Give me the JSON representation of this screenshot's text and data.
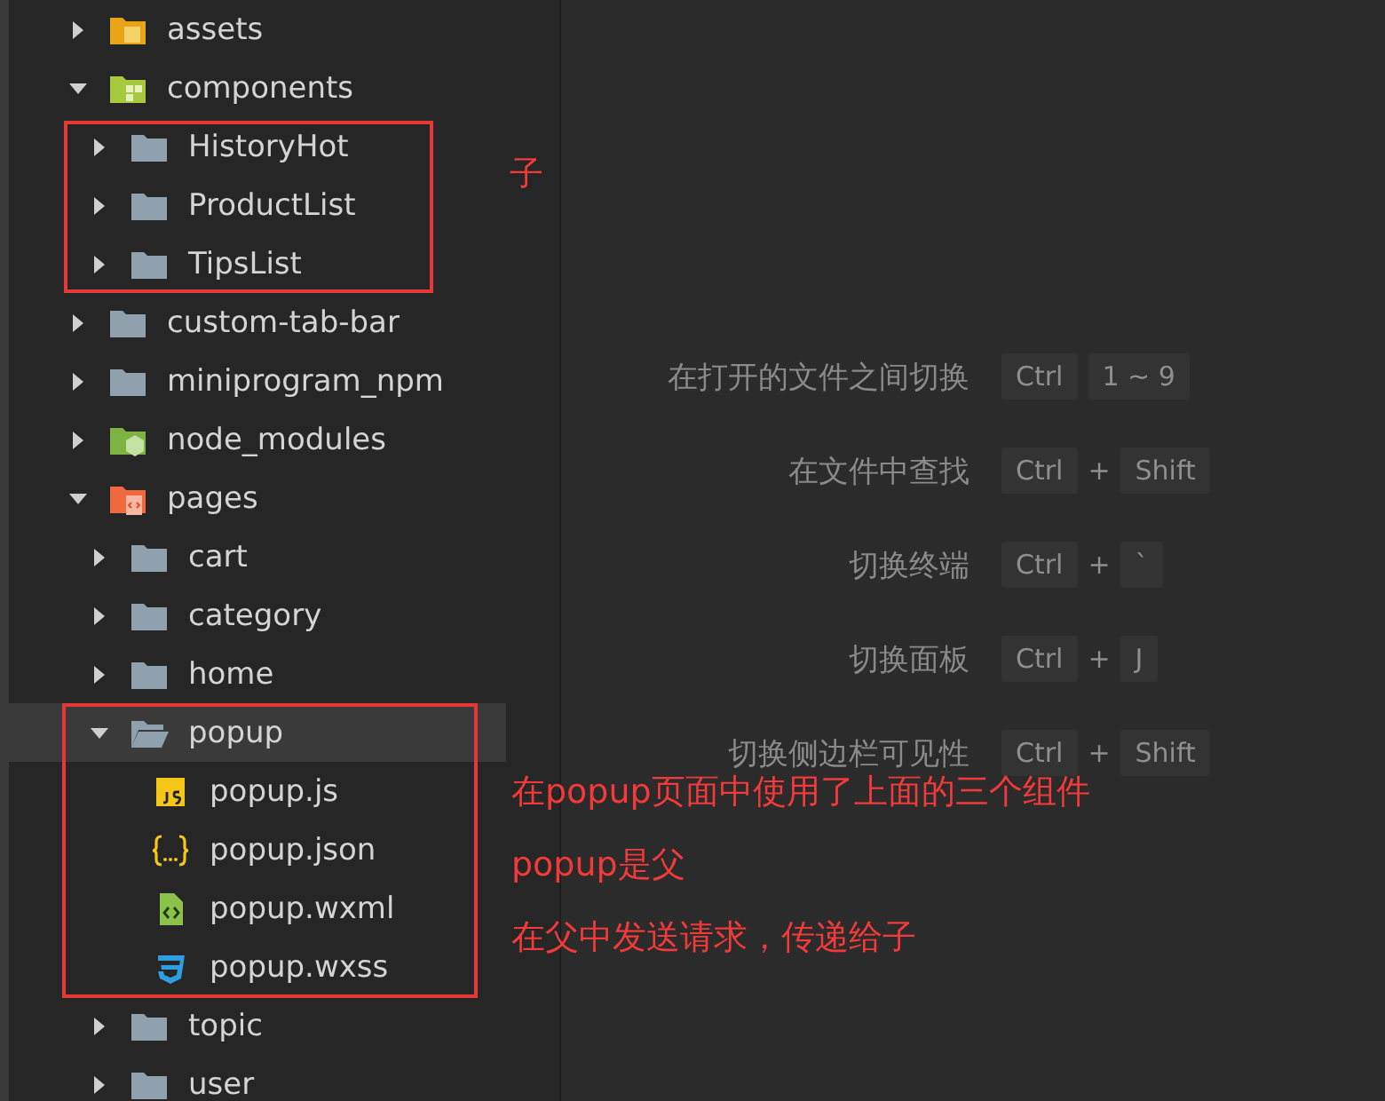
{
  "explorer": {
    "items": [
      {
        "name": "assets",
        "kind": "folder-assets",
        "expanded": false,
        "selected": false
      },
      {
        "name": "components",
        "kind": "folder-components",
        "expanded": true,
        "selected": false,
        "children": [
          {
            "name": "HistoryHot",
            "kind": "folder",
            "expanded": false,
            "selected": false
          },
          {
            "name": "ProductList",
            "kind": "folder",
            "expanded": false,
            "selected": false
          },
          {
            "name": "TipsList",
            "kind": "folder",
            "expanded": false,
            "selected": false
          }
        ]
      },
      {
        "name": "custom-tab-bar",
        "kind": "folder",
        "expanded": false,
        "selected": false
      },
      {
        "name": "miniprogram_npm",
        "kind": "folder",
        "expanded": false,
        "selected": false
      },
      {
        "name": "node_modules",
        "kind": "folder-node",
        "expanded": false,
        "selected": false
      },
      {
        "name": "pages",
        "kind": "folder-pages",
        "expanded": true,
        "selected": false,
        "children": [
          {
            "name": "cart",
            "kind": "folder",
            "expanded": false,
            "selected": false
          },
          {
            "name": "category",
            "kind": "folder",
            "expanded": false,
            "selected": false
          },
          {
            "name": "home",
            "kind": "folder",
            "expanded": false,
            "selected": false
          },
          {
            "name": "popup",
            "kind": "folder",
            "expanded": true,
            "selected": true,
            "children": [
              {
                "name": "popup.js",
                "kind": "js",
                "selected": false
              },
              {
                "name": "popup.json",
                "kind": "json",
                "selected": false
              },
              {
                "name": "popup.wxml",
                "kind": "wxml",
                "selected": false
              },
              {
                "name": "popup.wxss",
                "kind": "wxss",
                "selected": false
              }
            ]
          },
          {
            "name": "topic",
            "kind": "folder",
            "expanded": false,
            "selected": false
          },
          {
            "name": "user",
            "kind": "folder",
            "expanded": false,
            "selected": false
          }
        ]
      }
    ]
  },
  "shortcuts": [
    {
      "label": "在打开的文件之间切换",
      "keys": [
        {
          "kind": "key",
          "text": "Ctrl"
        },
        {
          "kind": "key",
          "text": "1 ~ 9"
        }
      ]
    },
    {
      "label": "在文件中查找",
      "keys": [
        {
          "kind": "key",
          "text": "Ctrl"
        },
        {
          "kind": "plus",
          "text": "+"
        },
        {
          "kind": "key",
          "text": "Shift"
        }
      ]
    },
    {
      "label": "切换终端",
      "keys": [
        {
          "kind": "key",
          "text": "Ctrl"
        },
        {
          "kind": "plus",
          "text": "+"
        },
        {
          "kind": "key",
          "text": "`"
        }
      ]
    },
    {
      "label": "切换面板",
      "keys": [
        {
          "kind": "key",
          "text": "Ctrl"
        },
        {
          "kind": "plus",
          "text": "+"
        },
        {
          "kind": "key",
          "text": "J"
        }
      ]
    },
    {
      "label": "切换侧边栏可见性",
      "keys": [
        {
          "kind": "key",
          "text": "Ctrl"
        },
        {
          "kind": "plus",
          "text": "+"
        },
        {
          "kind": "key",
          "text": "Shift"
        }
      ]
    }
  ],
  "annotations": [
    {
      "kind": "components-note",
      "lines": [
        "子"
      ]
    },
    {
      "kind": "popup-note",
      "lines": [
        "在popup页面中使用了上面的三个组件",
        "popup是父",
        "在父中发送请求，传递给子"
      ]
    }
  ]
}
